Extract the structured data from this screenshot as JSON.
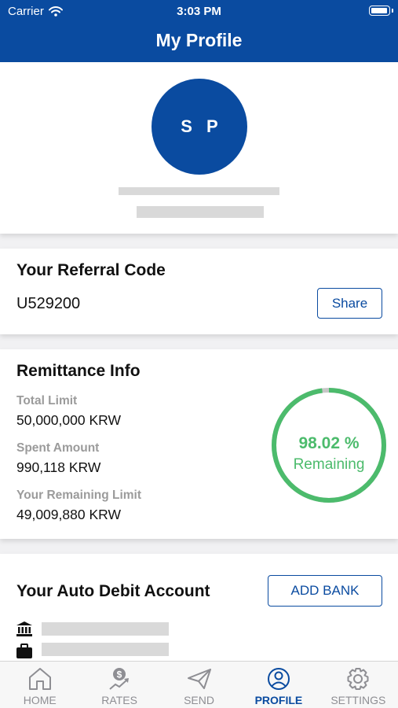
{
  "status_bar": {
    "carrier": "Carrier",
    "time": "3:03 PM"
  },
  "nav": {
    "title": "My Profile"
  },
  "profile": {
    "initials": "S P"
  },
  "referral": {
    "title": "Your Referral Code",
    "code": "U529200",
    "share_label": "Share"
  },
  "remittance": {
    "title": "Remittance Info",
    "total_limit_label": "Total Limit",
    "total_limit_value": "50,000,000 KRW",
    "spent_label": "Spent Amount",
    "spent_value": "990,118 KRW",
    "remaining_label": "Your Remaining Limit",
    "remaining_value": "49,009,880 KRW",
    "percent_text": "98.02 %",
    "remaining_text": "Remaining",
    "remaining_fraction": 0.9802
  },
  "auto_debit": {
    "title": "Your Auto Debit Account",
    "add_bank_label": "ADD BANK"
  },
  "tabs": [
    {
      "label": "HOME",
      "icon": "home-icon",
      "active": false
    },
    {
      "label": "RATES",
      "icon": "rates-icon",
      "active": false
    },
    {
      "label": "SEND",
      "icon": "send-icon",
      "active": false
    },
    {
      "label": "PROFILE",
      "icon": "profile-icon",
      "active": true
    },
    {
      "label": "SETTINGS",
      "icon": "gear-icon",
      "active": false
    }
  ],
  "colors": {
    "brand": "#0a4ba0",
    "success": "#4cbb6c",
    "inactive": "#8e8e93"
  }
}
